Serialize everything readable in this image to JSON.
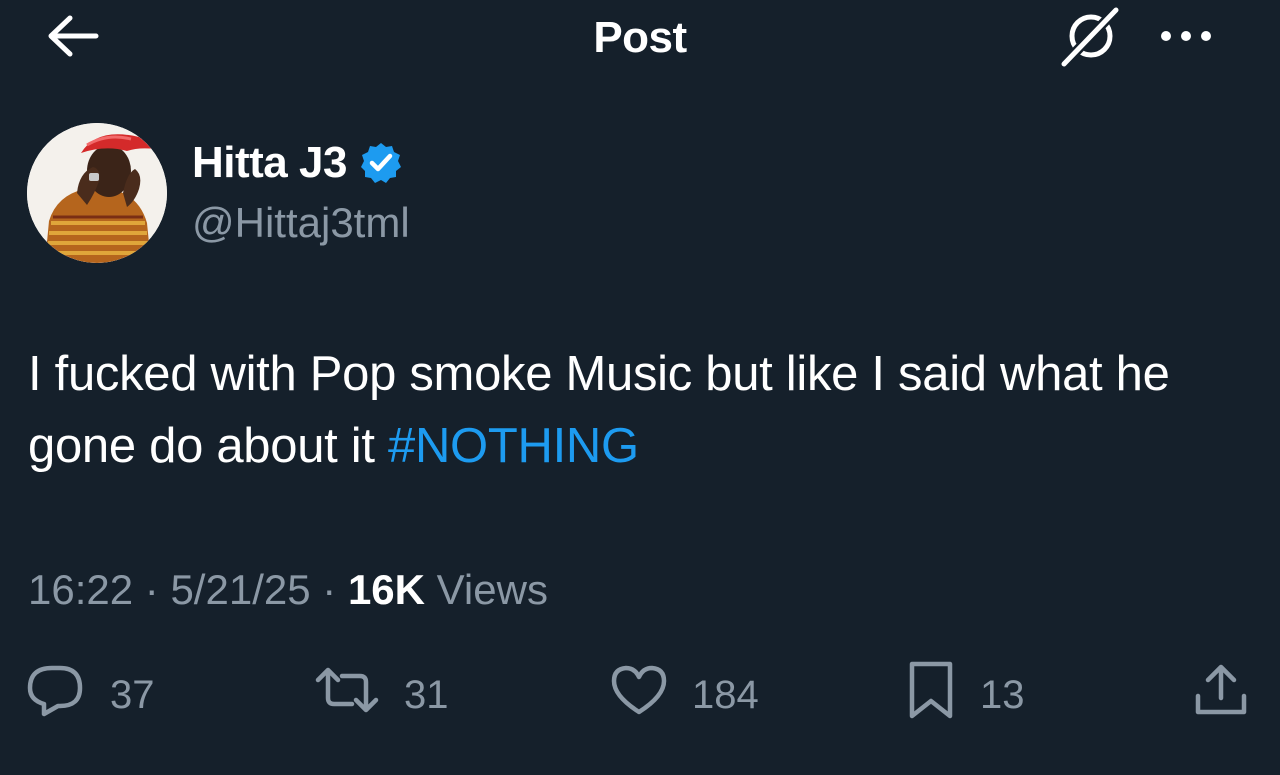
{
  "header": {
    "title": "Post",
    "back_icon": "arrow-left-icon",
    "grok_icon": "grok-icon",
    "more_icon": "more-dots-icon"
  },
  "author": {
    "display_name": "Hitta J3",
    "handle": "@Hittaj3tml",
    "verified": true,
    "verified_color": "#1d9bf0"
  },
  "tweet": {
    "text": "I fucked with Pop smoke Music but like I said what he gone do about it",
    "hashtag": "#NOTHING"
  },
  "meta": {
    "time": "16:22",
    "separator": "·",
    "date": "5/21/25",
    "views_count": "16K",
    "views_label": "Views"
  },
  "actions": {
    "replies": "37",
    "reposts": "31",
    "likes": "184",
    "bookmarks": "13"
  },
  "colors": {
    "background": "#15202b",
    "text": "#ffffff",
    "secondary": "#8b98a5",
    "accent": "#1d9bf0"
  }
}
